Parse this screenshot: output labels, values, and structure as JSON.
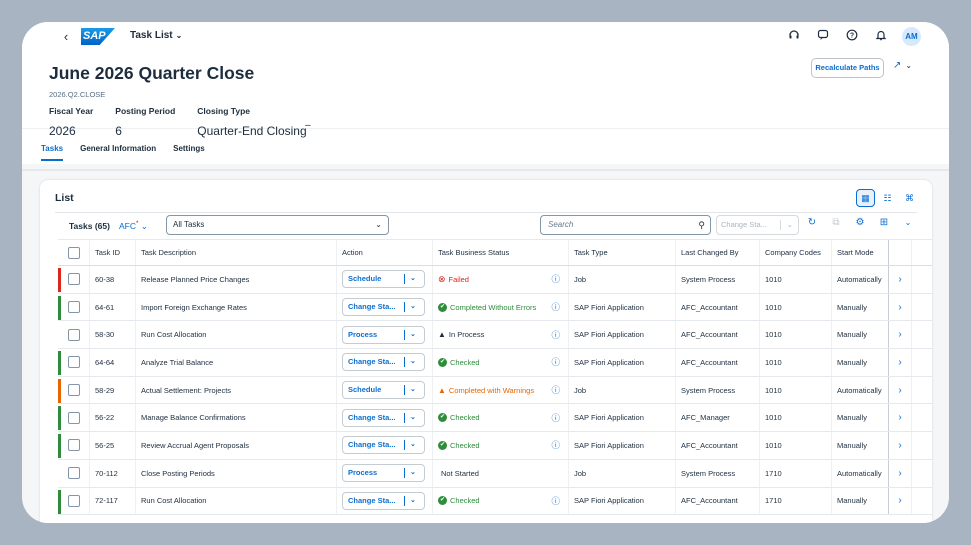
{
  "shell": {
    "app_title": "Task List",
    "logo_text": "SAP",
    "avatar_initials": "AM",
    "icons": [
      "headset-icon",
      "chat-icon",
      "help-icon",
      "bell-icon"
    ]
  },
  "header": {
    "title": "June 2026 Quarter Close",
    "subid": "2026.Q2.CLOSE",
    "recalculate_label": "Recalculate Paths",
    "attributes": [
      {
        "label": "Fiscal Year",
        "value": "2026"
      },
      {
        "label": "Posting Period",
        "value": "6"
      },
      {
        "label": "Closing Type",
        "value": "Quarter-End Closing"
      }
    ],
    "dash": "–"
  },
  "tabs": [
    {
      "label": "Tasks",
      "active": true
    },
    {
      "label": "General Information",
      "active": false
    },
    {
      "label": "Settings",
      "active": false
    }
  ],
  "list": {
    "title": "List",
    "tasks_count": "Tasks (65)",
    "afc_label": "AFC",
    "afc_marker": "*",
    "variant_value": "All Tasks",
    "search_placeholder": "Search",
    "change_status_label": "Change Sta...",
    "columns": [
      "Task ID",
      "Task Description",
      "Action",
      "Task Business Status",
      "Task Type",
      "Last Changed By",
      "Company Codes",
      "Start Mode"
    ]
  },
  "colors": {
    "accent": "#0a6ed1",
    "error": "#d9271d",
    "success": "#2e8c3b",
    "warning": "#e76500",
    "neutral": "#1d2d3e"
  },
  "rows": [
    {
      "indicator": "#d9271d",
      "id": "60-38",
      "desc": "Release Planned Price Changes",
      "action": "Schedule",
      "status": "Failed",
      "status_icon": "error-icon",
      "status_color": "#d9271d",
      "info": true,
      "type": "Job",
      "changed_by": "System Process",
      "cc": "1010",
      "start": "Automatically"
    },
    {
      "indicator": "#2e8c3b",
      "id": "64-61",
      "desc": "Import Foreign Exchange Rates",
      "action": "Change Sta...",
      "status": "Completed Without Errors",
      "status_icon": "success-icon",
      "status_color": "#2e8c3b",
      "info": true,
      "type": "SAP Fiori Application",
      "changed_by": "AFC_Accountant",
      "cc": "1010",
      "start": "Manually"
    },
    {
      "indicator": "",
      "id": "58-30",
      "desc": "Run Cost Allocation",
      "action": "Process",
      "status": "In Process",
      "status_icon": "warning-triangle-icon",
      "status_color": "#1d2d3e",
      "info": true,
      "type": "SAP Fiori Application",
      "changed_by": "AFC_Accountant",
      "cc": "1010",
      "start": "Manually"
    },
    {
      "indicator": "#2e8c3b",
      "id": "64-64",
      "desc": "Analyze Trial Balance",
      "action": "Change Sta...",
      "status": "Checked",
      "status_icon": "success-icon",
      "status_color": "#2e8c3b",
      "info": true,
      "type": "SAP Fiori Application",
      "changed_by": "AFC_Accountant",
      "cc": "1010",
      "start": "Manually"
    },
    {
      "indicator": "#e76500",
      "id": "58-29",
      "desc": "Actual Settlement: Projects",
      "action": "Schedule",
      "status": "Completed with Warnings",
      "status_icon": "warning-icon",
      "status_color": "#e76500",
      "info": true,
      "type": "Job",
      "changed_by": "System Process",
      "cc": "1010",
      "start": "Automatically"
    },
    {
      "indicator": "#2e8c3b",
      "id": "56-22",
      "desc": "Manage Balance Confirmations",
      "action": "Change Sta...",
      "status": "Checked",
      "status_icon": "success-icon",
      "status_color": "#2e8c3b",
      "info": true,
      "type": "SAP Fiori Application",
      "changed_by": "AFC_Manager",
      "cc": "1010",
      "start": "Manually"
    },
    {
      "indicator": "#2e8c3b",
      "id": "56-25",
      "desc": "Review Accrual Agent Proposals",
      "action": "Change Sta...",
      "status": "Checked",
      "status_icon": "success-icon",
      "status_color": "#2e8c3b",
      "info": true,
      "type": "SAP Fiori Application",
      "changed_by": "AFC_Accountant",
      "cc": "1010",
      "start": "Manually"
    },
    {
      "indicator": "",
      "id": "70-112",
      "desc": "Close Posting Periods",
      "action": "Process",
      "status": "Not Started",
      "status_icon": "",
      "status_color": "#1d2d3e",
      "info": false,
      "type": "Job",
      "changed_by": "System Process",
      "cc": "1710",
      "start": "Automatically"
    },
    {
      "indicator": "#2e8c3b",
      "id": "72-117",
      "desc": "Run Cost Allocation",
      "action": "Change Sta...",
      "status": "Checked",
      "status_icon": "success-icon",
      "status_color": "#2e8c3b",
      "info": true,
      "type": "SAP Fiori Application",
      "changed_by": "AFC_Accountant",
      "cc": "1710",
      "start": "Manually"
    }
  ]
}
